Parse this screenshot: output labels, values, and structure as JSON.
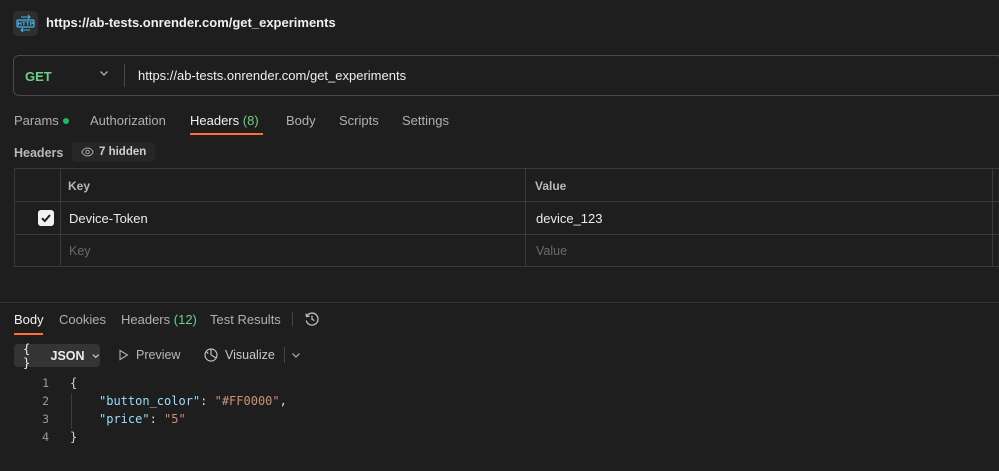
{
  "window": {
    "title": "https://ab-tests.onrender.com/get_experiments",
    "icon": "http-icon"
  },
  "request": {
    "method": "GET",
    "url": "https://ab-tests.onrender.com/get_experiments"
  },
  "request_tabs": [
    {
      "label": "Params",
      "dot": true
    },
    {
      "label": "Authorization"
    },
    {
      "label": "Headers",
      "count": "(8)",
      "active": true
    },
    {
      "label": "Body"
    },
    {
      "label": "Scripts"
    },
    {
      "label": "Settings"
    }
  ],
  "headers_section": {
    "label": "Headers",
    "hidden_label": "7 hidden",
    "columns": {
      "key": "Key",
      "value": "Value"
    },
    "rows": [
      {
        "checked": true,
        "key": "Device-Token",
        "value": "device_123"
      }
    ],
    "placeholder": {
      "key": "Key",
      "value": "Value"
    }
  },
  "response_tabs": [
    {
      "label": "Body",
      "active": true
    },
    {
      "label": "Cookies"
    },
    {
      "label": "Headers",
      "count": "(12)"
    },
    {
      "label": "Test Results"
    }
  ],
  "response_toolbar": {
    "format": "JSON",
    "format_icon": "{ }",
    "preview": "Preview",
    "visualize": "Visualize"
  },
  "response_body": {
    "line_numbers": [
      "1",
      "2",
      "3",
      "4"
    ],
    "open_brace": "{",
    "close_brace": "}",
    "entries": [
      {
        "key": "\"button_color\"",
        "value": "\"#FF0000\"",
        "trailing": ","
      },
      {
        "key": "\"price\"",
        "value": "\"5\"",
        "trailing": ""
      }
    ]
  },
  "colors": {
    "accent": "#ff6c37",
    "method_get": "#6cd184",
    "json_key": "#9cdcfe",
    "json_string": "#ce9178"
  }
}
